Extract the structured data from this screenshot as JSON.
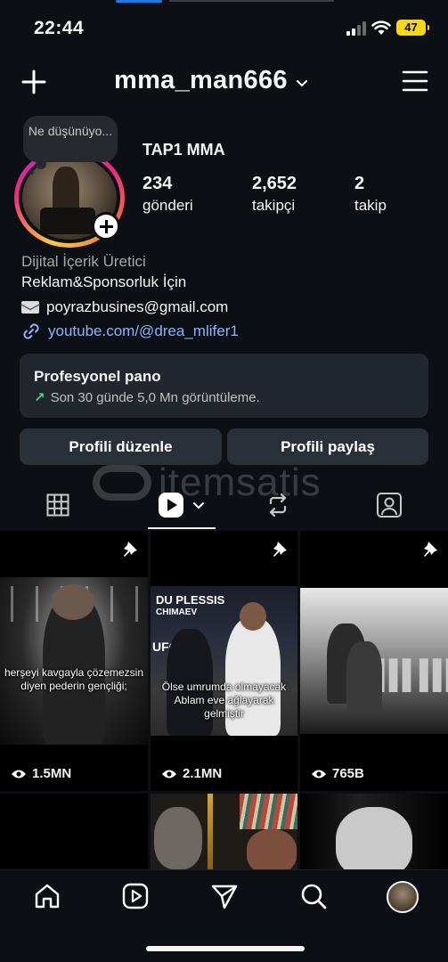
{
  "status_bar": {
    "time": "22:44",
    "battery": "47"
  },
  "header": {
    "username": "mma_man666"
  },
  "note": {
    "text": "Ne düşünüyo..."
  },
  "profile": {
    "display_name": "TAP1 MMA",
    "stats": [
      {
        "value": "234",
        "label": "gönderi"
      },
      {
        "value": "2,652",
        "label": "takipçi"
      },
      {
        "value": "2",
        "label": "takip"
      }
    ],
    "category": "Dijital İçerik Üretici",
    "bio_line": "Reklam&Sponsorluk İçin",
    "email": "poyrazbusines@gmail.com",
    "link": "youtube.com/@drea_mlifer1"
  },
  "dashboard": {
    "title": "Profesyonel pano",
    "subtitle": "Son 30 günde 5,0 Mn görüntüleme."
  },
  "buttons": {
    "edit": "Profili düzenle",
    "share": "Profili paylaş"
  },
  "watermark": "itemsatis",
  "posts": [
    {
      "caption": "herşeyi kavgayla çözemezsin diyen pederin gençliği;",
      "views": "1.5MN",
      "pinned": true
    },
    {
      "caption": "Ölse umrumda olmayacak Ablam eve ağlayarak gelmiştir",
      "views": "2.1MN",
      "pinned": true,
      "poster_top": "DU PLESSIS",
      "poster_sub": "CHIMAEV",
      "event": "UFC"
    },
    {
      "caption": "",
      "views": "765B",
      "pinned": true
    }
  ],
  "colors": {
    "background": "#0c1014",
    "button": "#2a3038",
    "link": "#8ab4ff",
    "trend": "#39d98a",
    "battery": "#f5d90a"
  }
}
